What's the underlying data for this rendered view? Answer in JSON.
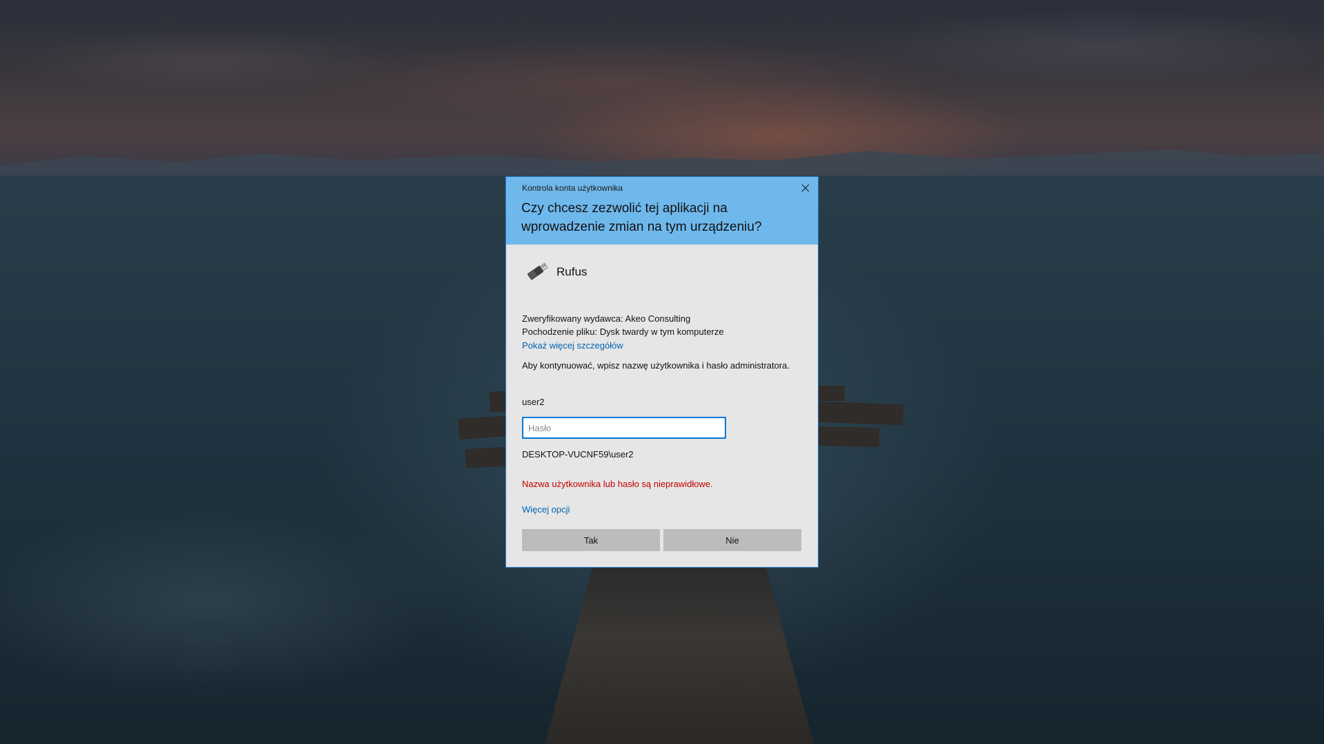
{
  "dialog": {
    "caption": "Kontrola konta użytkownika",
    "question": "Czy chcesz zezwolić tej aplikacji na wprowadzenie zmian na tym urządzeniu?",
    "app_name": "Rufus",
    "app_icon": "usb-drive-icon",
    "publisher": "Zweryfikowany wydawca: Akeo Consulting",
    "file_origin": "Pochodzenie pliku: Dysk twardy w tym komputerze",
    "details_link": "Pokaż więcej szczegółów",
    "prompt": "Aby kontynuować, wpisz nazwę użytkownika i hasło administratora.",
    "username": "user2",
    "password_placeholder": "Hasło",
    "password_value": "",
    "domain_user": "DESKTOP-VUCNF59\\user2",
    "error": "Nazwa użytkownika lub hasło są nieprawidłowe.",
    "more_options_link": "Więcej opcji",
    "yes_label": "Tak",
    "no_label": "Nie"
  },
  "colors": {
    "header_bg": "#6fb8ec",
    "dialog_bg": "#e6e6e6",
    "link": "#0063b1",
    "error": "#c40000",
    "button_bg": "#bcbcbc",
    "input_border": "#0078d7"
  }
}
